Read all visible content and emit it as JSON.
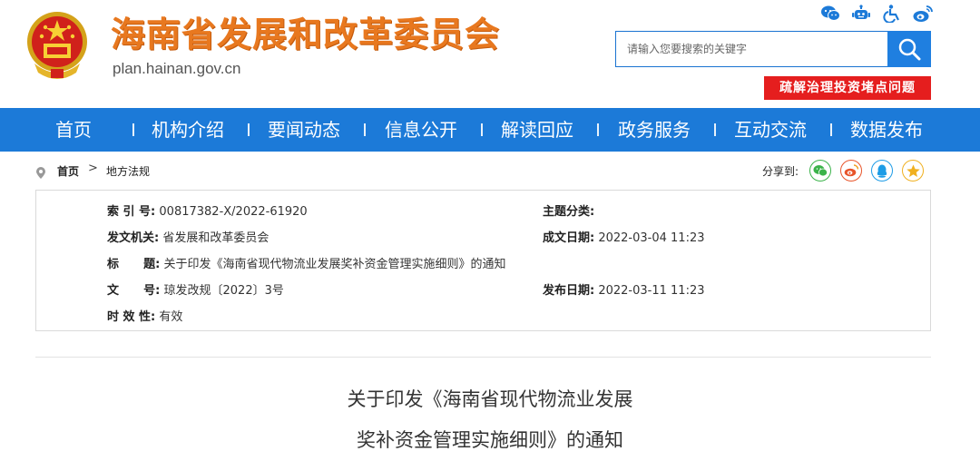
{
  "header": {
    "site_title": "海南省发展和改革委员会",
    "site_domain": "plan.hainan.gov.cn",
    "top_icons": [
      "wechat-icon",
      "robot-icon",
      "accessibility-icon",
      "weibo-icon"
    ],
    "search": {
      "placeholder": "请输入您要搜索的关键字"
    },
    "promo_label": "疏解治理投资堵点问题"
  },
  "nav": {
    "items": [
      {
        "label": "首页"
      },
      {
        "label": "机构介绍"
      },
      {
        "label": "要闻动态"
      },
      {
        "label": "信息公开"
      },
      {
        "label": "解读回应"
      },
      {
        "label": "政务服务"
      },
      {
        "label": "互动交流"
      },
      {
        "label": "数据发布"
      }
    ]
  },
  "breadcrumb": {
    "home": "首页",
    "separator": ">",
    "current": "地方法规",
    "share_label": "分享到:",
    "share_icons": [
      "wechat-share-icon",
      "weibo-share-icon",
      "qq-share-icon",
      "qzone-share-icon"
    ]
  },
  "meta": {
    "index_key": "索 引 号:",
    "index_val": "00817382-X/2022-61920",
    "topic_key": "主题分类:",
    "topic_val": "",
    "issuer_key": "发文机关:",
    "issuer_val": "省发展和改革委员会",
    "date_key": "成文日期:",
    "date_val": "2022-03-04 11:23",
    "title_key": "标      题:",
    "title_val": "关于印发《海南省现代物流业发展奖补资金管理实施细则》的通知",
    "docno_key": "文      号:",
    "docno_val": "琼发改规〔2022〕3号",
    "publish_key": "发布日期:",
    "publish_val": "2022-03-11 11:23",
    "validity_key": "时 效 性:",
    "validity_val": "有效"
  },
  "document": {
    "title_line1": "关于印发《海南省现代物流业发展",
    "title_line2": "奖补资金管理实施细则》的通知"
  },
  "colors": {
    "nav_bg": "#1c7ad8",
    "title_orange": "#e8781f",
    "promo_red": "#e51e1e",
    "search_blue": "#1f7fe0"
  }
}
